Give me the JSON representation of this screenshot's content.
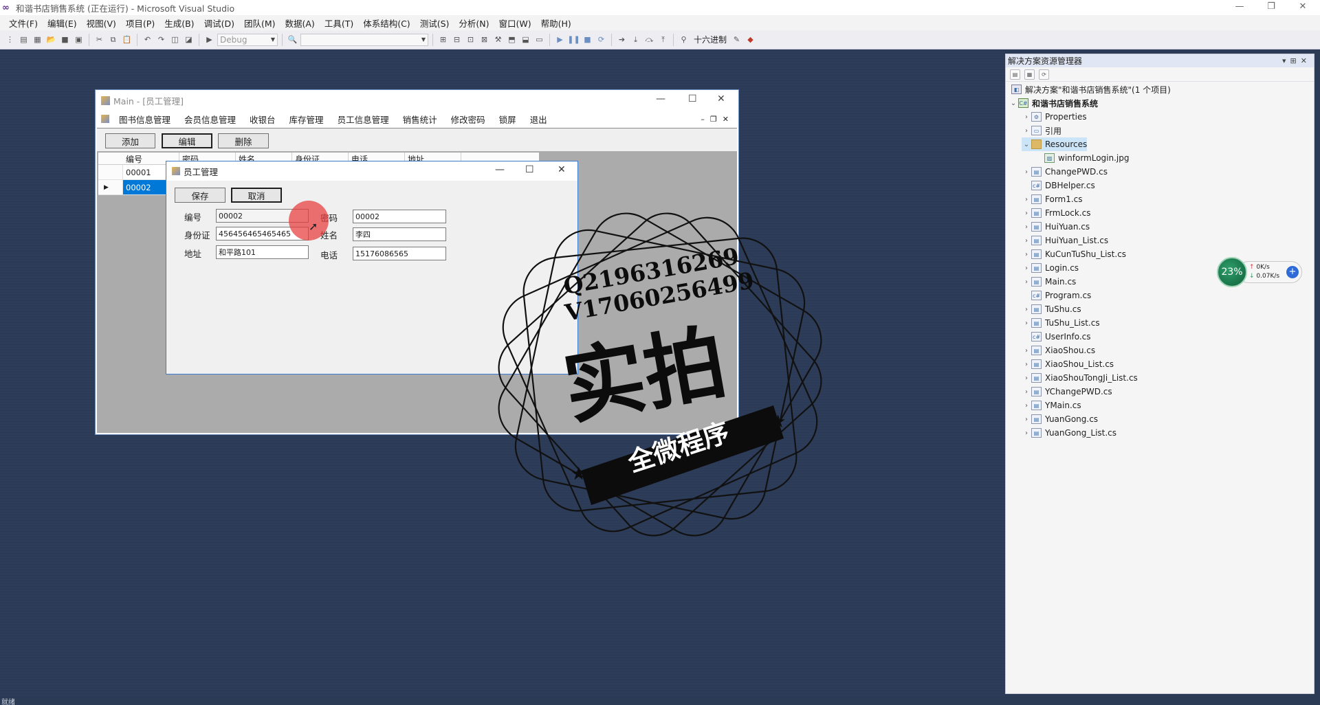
{
  "window": {
    "title": "和谐书店销售系统 (正在运行) - Microsoft Visual Studio"
  },
  "menu": [
    "文件(F)",
    "编辑(E)",
    "视图(V)",
    "项目(P)",
    "生成(B)",
    "调试(D)",
    "团队(M)",
    "数据(A)",
    "工具(T)",
    "体系结构(C)",
    "测试(S)",
    "分析(N)",
    "窗口(W)",
    "帮助(H)"
  ],
  "toolbar": {
    "config": "Debug",
    "hex_label": "十六进制"
  },
  "solution_explorer": {
    "title": "解决方案资源管理器",
    "solution": "解决方案\"和谐书店销售系统\"(1 个项目)",
    "project": "和谐书店销售系统",
    "items": [
      {
        "label": "Properties",
        "icon": "properties-icon",
        "expand": "collapsed",
        "indent": 2
      },
      {
        "label": "引用",
        "icon": "references-icon",
        "expand": "collapsed",
        "indent": 2
      },
      {
        "label": "Resources",
        "icon": "folder-icon",
        "expand": "expanded",
        "indent": 2,
        "selected": true
      },
      {
        "label": "winformLogin.jpg",
        "icon": "image-file-icon",
        "expand": "none",
        "indent": 3
      },
      {
        "label": "ChangePWD.cs",
        "icon": "form-file-icon",
        "expand": "collapsed",
        "indent": 2
      },
      {
        "label": "DBHelper.cs",
        "icon": "cs-file-icon",
        "expand": "none",
        "indent": 2
      },
      {
        "label": "Form1.cs",
        "icon": "form-file-icon",
        "expand": "collapsed",
        "indent": 2
      },
      {
        "label": "FrmLock.cs",
        "icon": "form-file-icon",
        "expand": "collapsed",
        "indent": 2
      },
      {
        "label": "HuiYuan.cs",
        "icon": "form-file-icon",
        "expand": "collapsed",
        "indent": 2
      },
      {
        "label": "HuiYuan_List.cs",
        "icon": "form-file-icon",
        "expand": "collapsed",
        "indent": 2
      },
      {
        "label": "KuCunTuShu_List.cs",
        "icon": "form-file-icon",
        "expand": "collapsed",
        "indent": 2
      },
      {
        "label": "Login.cs",
        "icon": "form-file-icon",
        "expand": "collapsed",
        "indent": 2
      },
      {
        "label": "Main.cs",
        "icon": "form-file-icon",
        "expand": "collapsed",
        "indent": 2
      },
      {
        "label": "Program.cs",
        "icon": "cs-file-icon",
        "expand": "none",
        "indent": 2
      },
      {
        "label": "TuShu.cs",
        "icon": "form-file-icon",
        "expand": "collapsed",
        "indent": 2
      },
      {
        "label": "TuShu_List.cs",
        "icon": "form-file-icon",
        "expand": "collapsed",
        "indent": 2
      },
      {
        "label": "UserInfo.cs",
        "icon": "cs-file-icon",
        "expand": "none",
        "indent": 2
      },
      {
        "label": "XiaoShou.cs",
        "icon": "form-file-icon",
        "expand": "collapsed",
        "indent": 2
      },
      {
        "label": "XiaoShou_List.cs",
        "icon": "form-file-icon",
        "expand": "collapsed",
        "indent": 2
      },
      {
        "label": "XiaoShouTongJi_List.cs",
        "icon": "form-file-icon",
        "expand": "collapsed",
        "indent": 2
      },
      {
        "label": "YChangePWD.cs",
        "icon": "form-file-icon",
        "expand": "collapsed",
        "indent": 2
      },
      {
        "label": "YMain.cs",
        "icon": "form-file-icon",
        "expand": "collapsed",
        "indent": 2
      },
      {
        "label": "YuanGong.cs",
        "icon": "form-file-icon",
        "expand": "collapsed",
        "indent": 2
      },
      {
        "label": "YuanGong_List.cs",
        "icon": "form-file-icon",
        "expand": "collapsed",
        "indent": 2
      }
    ]
  },
  "main_form": {
    "title": "Main - [员工管理]",
    "menu": [
      "图书信息管理",
      "会员信息管理",
      "收银台",
      "库存管理",
      "员工信息管理",
      "销售统计",
      "修改密码",
      "锁屏",
      "退出"
    ],
    "buttons": {
      "add": "添加",
      "edit": "编辑",
      "delete": "删除"
    },
    "grid": {
      "columns": [
        "编号",
        "密码",
        "姓名",
        "身份证",
        "电话",
        "地址"
      ],
      "rows": [
        {
          "id": "00001"
        },
        {
          "id": "00002",
          "selected": true
        }
      ]
    }
  },
  "dialog": {
    "title": "员工管理",
    "buttons": {
      "save": "保存",
      "cancel": "取消"
    },
    "fields": {
      "id_label": "编号",
      "id_value": "00002",
      "pwd_label": "密码",
      "pwd_value": "00002",
      "idcard_label": "身份证",
      "idcard_value": "456456465465465",
      "name_label": "姓名",
      "name_value": "李四",
      "address_label": "地址",
      "address_value": "和平路101",
      "phone_label": "电话",
      "phone_value": "15176086565"
    }
  },
  "watermark": {
    "line1": "Q2196316269",
    "line2": "V17060256499",
    "big": "实拍",
    "banner": "全微程序"
  },
  "net_widget": {
    "percent": "23%",
    "upload": "0K/s",
    "download": "0.07K/s"
  },
  "status": {
    "text": "就绪"
  }
}
